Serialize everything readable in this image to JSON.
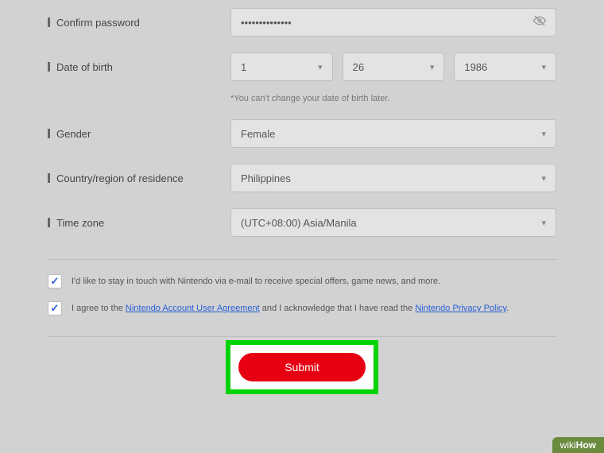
{
  "fields": {
    "confirm_password": {
      "label": "Confirm password",
      "value": "••••••••••••••"
    },
    "dob": {
      "label": "Date of birth",
      "day": "1",
      "month": "26",
      "year": "1986",
      "note": "*You can't change your date of birth later."
    },
    "gender": {
      "label": "Gender",
      "value": "Female"
    },
    "country": {
      "label": "Country/region of residence",
      "value": "Philippines"
    },
    "timezone": {
      "label": "Time zone",
      "value": "(UTC+08:00) Asia/Manila"
    }
  },
  "checkboxes": {
    "newsletter": {
      "checked": true,
      "text": "I'd like to stay in touch with Nintendo via e-mail to receive special offers, game news, and more."
    },
    "agreement": {
      "checked": true,
      "prefix": "I agree to the ",
      "link1": "Nintendo Account User Agreement",
      "mid": " and I acknowledge that I have read the ",
      "link2": "Nintendo Privacy Policy",
      "suffix": "."
    }
  },
  "submit": {
    "label": "Submit"
  },
  "watermark": {
    "prefix": "wiki",
    "suffix": "How"
  }
}
